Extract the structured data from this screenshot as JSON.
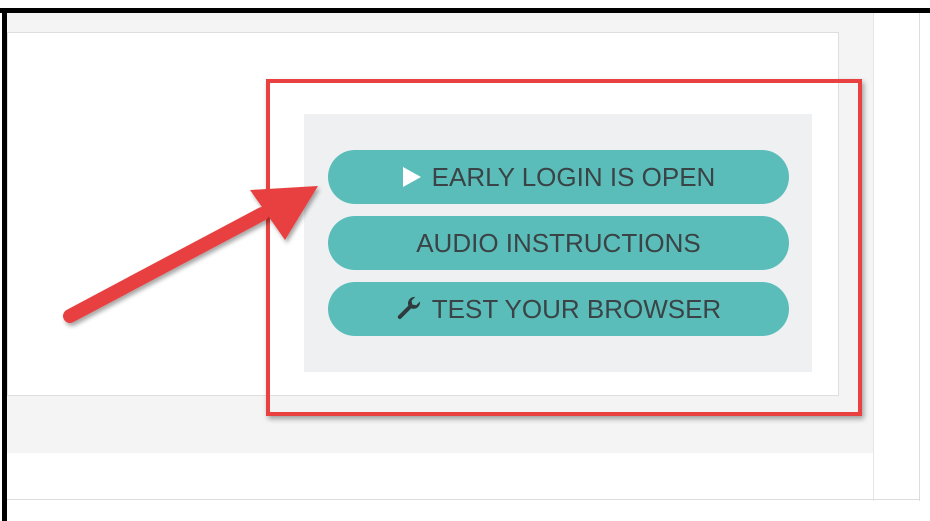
{
  "buttons": {
    "early_login": {
      "label": "EARLY LOGIN IS OPEN",
      "icon": "play-icon"
    },
    "audio_instructions": {
      "label": "AUDIO INSTRUCTIONS"
    },
    "test_browser": {
      "label": "TEST YOUR BROWSER",
      "icon": "wrench-icon"
    }
  },
  "colors": {
    "button_bg": "#5bbdb9",
    "button_text": "#3a4346",
    "panel_bg": "#eef0f2",
    "annotation_red": "#e8413f"
  }
}
